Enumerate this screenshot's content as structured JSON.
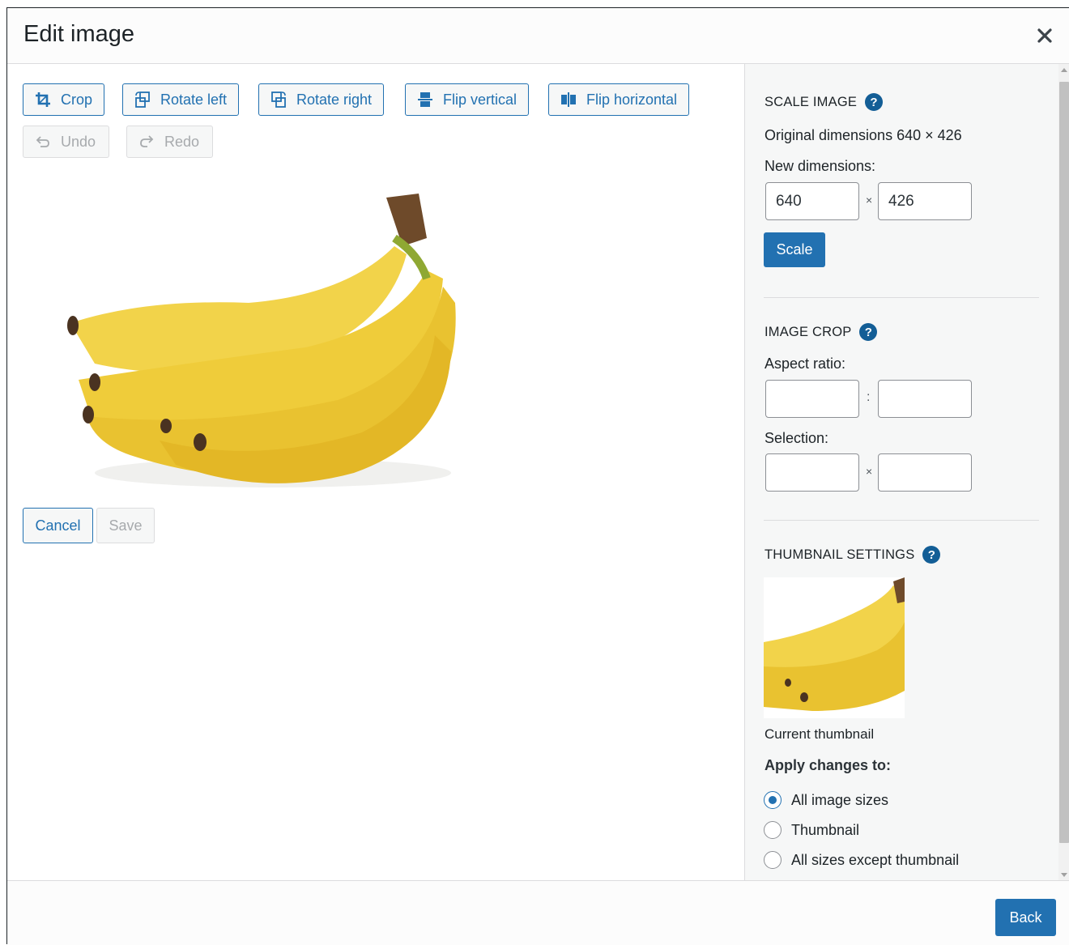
{
  "header": {
    "title": "Edit image"
  },
  "toolbar": {
    "crop": "Crop",
    "rotate_left": "Rotate left",
    "rotate_right": "Rotate right",
    "flip_vertical": "Flip vertical",
    "flip_horizontal": "Flip horizontal",
    "undo": "Undo",
    "redo": "Redo"
  },
  "actions": {
    "cancel": "Cancel",
    "save": "Save"
  },
  "scale_image": {
    "title": "Scale Image",
    "original_dimensions": "Original dimensions 640 × 426",
    "new_dimensions_label": "New dimensions:",
    "width": "640",
    "height": "426",
    "separator": "×",
    "button": "Scale"
  },
  "image_crop": {
    "title": "Image Crop",
    "aspect_ratio_label": "Aspect ratio:",
    "aspect_separator": ":",
    "selection_label": "Selection:",
    "selection_separator": "×"
  },
  "thumbnail_settings": {
    "title": "Thumbnail Settings",
    "caption": "Current thumbnail",
    "apply_label": "Apply changes to:",
    "options": [
      {
        "label": "All image sizes",
        "checked": true
      },
      {
        "label": "Thumbnail",
        "checked": false
      },
      {
        "label": "All sizes except thumbnail",
        "checked": false
      }
    ]
  },
  "footer": {
    "back": "Back"
  },
  "colors": {
    "accent": "#2271b1",
    "help": "#135e96",
    "sidebar_bg": "#f6f7f7"
  },
  "icons": [
    "close-icon",
    "crop-icon",
    "rotate-left-icon",
    "rotate-right-icon",
    "flip-vertical-icon",
    "flip-horizontal-icon",
    "undo-icon",
    "redo-icon",
    "help-icon"
  ]
}
